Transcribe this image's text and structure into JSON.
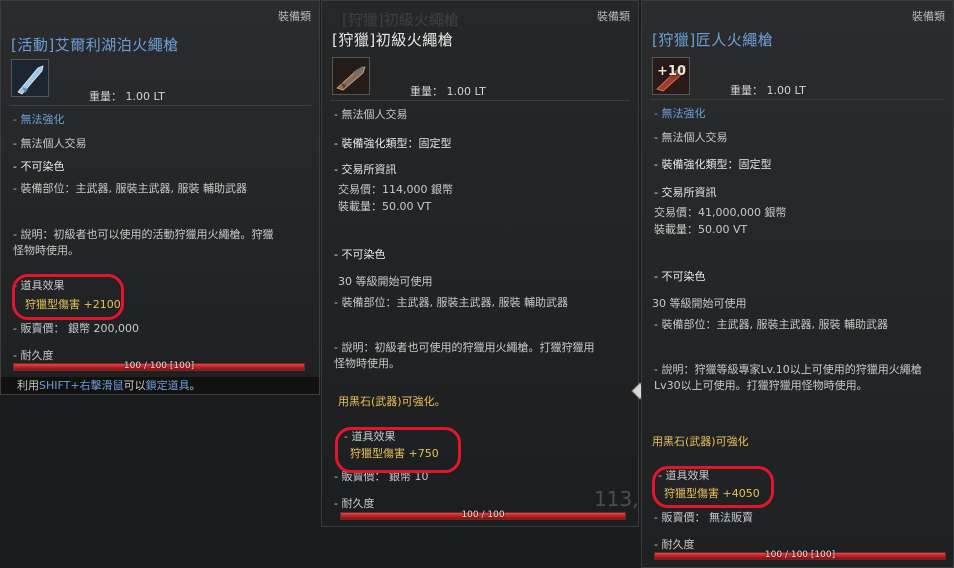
{
  "panels": [
    {
      "category": "裝備類",
      "title": "[活動]艾爾利湖泊火繩槍",
      "weight": "重量： 1.00 LT",
      "lines": {
        "l1": "- 無法強化",
        "l2": "- 無法個人交易",
        "l3": "- 不可染色",
        "l4": "- 裝備部位：主武器, 服裝主武器, 服裝 輔助武器",
        "l5": "- 說明：初級者也可以使用的活動狩獵用火繩槍。狩獵怪物時使用。",
        "l6": "- 道具效果",
        "l7": "狩獵型傷害 +2100",
        "l8": "- 販賣價： 銀幣 200,000",
        "l9": "- 耐久度"
      },
      "durability": "100 / 100 [100]",
      "hint_pre": "利用",
      "hint_key": "SHIFT+右擊滑鼠",
      "hint_mid": "可以",
      "hint_key2": "鎖定道具",
      "hint_end": "。"
    },
    {
      "category": "裝備類",
      "title": "[狩獵]初級火繩槍",
      "ghost_title": "[狩獵]初級火繩槍",
      "weight": "重量： 1.00 LT",
      "lines": {
        "l1": "- 無法個人交易",
        "l2": "- 裝備強化類型：固定型",
        "l3": "- 交易所資訊",
        "l4": "交易價：114,000 銀幣",
        "l5": "裝載量：50.00 VT",
        "l6": "- 不可染色",
        "l7": "30 等級開始可使用",
        "l8": "- 裝備部位：主武器, 服裝主武器, 服裝 輔助武器",
        "l9": "- 說明：初級者也可使用的狩獵用火繩槍。打獵狩獵用怪物時使用。",
        "l10": "用黑石(武器)可強化。",
        "l11": "- 道具效果",
        "l12": "狩獵型傷害 +750",
        "l13": "- 販賣價： 銀幣 10",
        "l14": "- 耐久度"
      },
      "durability": "100 / 100",
      "bg_number": "113,"
    },
    {
      "category": "裝備類",
      "title": "[狩獵]匠人火繩槍",
      "enhance": "+10",
      "weight": "重量： 1.00 LT",
      "lines": {
        "l1": "- 無法強化",
        "l2": "- 無法個人交易",
        "l3": "- 裝備強化類型：固定型",
        "l4": "- 交易所資訊",
        "l5": "交易價：41,000,000 銀幣",
        "l6": "裝載量：50.00 VT",
        "l7": "- 不可染色",
        "l8": "30 等級開始可使用",
        "l9": "- 裝備部位：主武器, 服裝主武器, 服裝 輔助武器",
        "l10": "- 說明：狩獵等級專家Lv.10以上可使用的狩獵用火繩槍Lv30以上可使用。打獵狩獵用怪物時使用。",
        "l11": "用黑石(武器)可強化",
        "l12": "- 道具效果",
        "l13": "狩獵型傷害 +4050",
        "l14": "- 販賣價： 無法販賣",
        "l15": "- 耐久度"
      },
      "durability": "100 / 100 [100]"
    }
  ],
  "colors": {
    "title_blue": "#6d9ed8",
    "title_white": "#e8e8e8",
    "effect_gold": "#e6c15a",
    "highlight_red": "#e2162b",
    "durability_red": "#c8262a"
  }
}
